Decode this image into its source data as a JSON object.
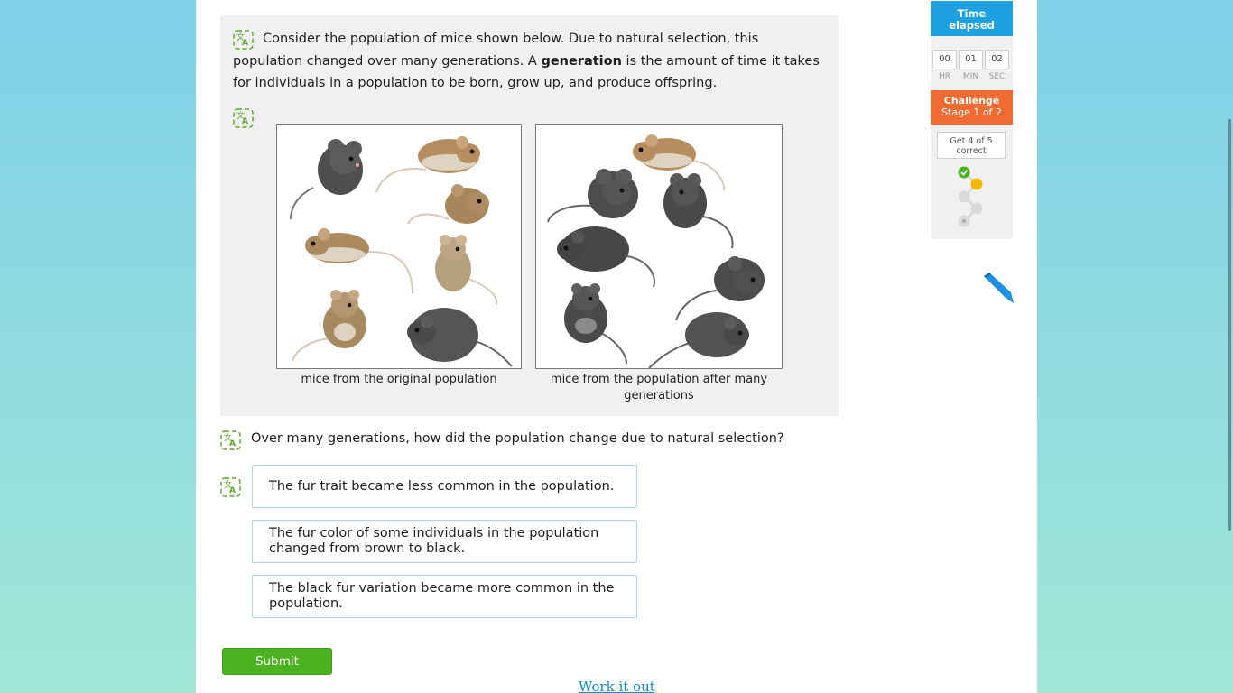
{
  "passage": {
    "line1": "Consider the population of mice shown below. Due to natural selection, this",
    "line2_pre": "population changed over many generations. A ",
    "line2_bold": "generation",
    "line2_post": " is the amount of time it takes",
    "line3": "for individuals in a population to be born, grow up, and produce offspring."
  },
  "figures": {
    "left_caption": "mice from the original population",
    "right_caption_line1": "mice from the population after many",
    "right_caption_line2": "generations"
  },
  "question": "Over many generations, how did the population change due to natural selection?",
  "choices": [
    {
      "line1": "The fur trait became less common in the population.",
      "line2": ""
    },
    {
      "line1": "The fur color of some individuals in the population",
      "line2": "changed from brown to black."
    },
    {
      "line1": "The black fur variation became more common in the",
      "line2": "population."
    }
  ],
  "submit_label": "Submit",
  "work_it_out_label": "Work it out",
  "timer": {
    "heading_line1": "Time",
    "heading_line2": "elapsed",
    "hr": "00",
    "min": "01",
    "sec": "02",
    "hr_label": "HR",
    "min_label": "MIN",
    "sec_label": "SEC"
  },
  "challenge": {
    "title": "Challenge",
    "stage": "Stage 1 of 2",
    "goal_line1": "Get 4 of 5",
    "goal_line2": "correct"
  },
  "colors": {
    "accent_blue": "#1da1e0",
    "challenge_orange": "#f06b31",
    "submit_green": "#4bb31f",
    "progress_correct": "#4bb31f",
    "progress_current": "#f5b800",
    "progress_pending": "#d9d9d9",
    "mouse_brown": "#b08a5a",
    "mouse_black": "#4a4a4a"
  },
  "icons": [
    "translate-icon",
    "check-icon",
    "pencil-icon"
  ]
}
